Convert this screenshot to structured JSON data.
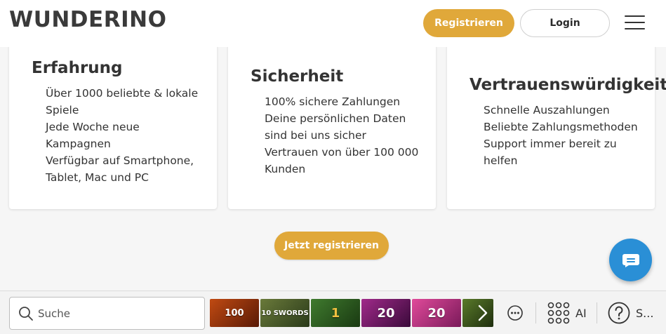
{
  "header": {
    "logo": "WUNDERINO",
    "register_label": "Registrieren",
    "login_label": "Login"
  },
  "cards": [
    {
      "title": "Erfahrung",
      "lines": [
        "Über 1000 beliebte & lokale",
        "Spiele",
        "Jede Woche neue",
        "Kampagnen",
        "Verfügbar auf Smartphone,",
        "Tablet, Mac und PC"
      ]
    },
    {
      "title": "Sicherheit",
      "lines": [
        "100% sichere Zahlungen",
        "Deine persönlichen Daten",
        "sind bei uns sicher",
        "Vertrauen von über 100 000",
        "Kunden"
      ]
    },
    {
      "title": "Vertrauenswürdigkeit",
      "lines": [
        "Schnelle Auszahlungen",
        "Beliebte Zahlungsmethoden",
        "Support immer bereit zu",
        "helfen"
      ]
    }
  ],
  "cta": {
    "label": "Jetzt registrieren"
  },
  "bottombar": {
    "search_placeholder": "Suche",
    "thumbnails": [
      {
        "text": "100",
        "bg": "#8a3a12"
      },
      {
        "text": "10 SWORDS",
        "bg": "#4a5a2a"
      },
      {
        "text": "1",
        "bg": "#2f5a24"
      },
      {
        "text": "20",
        "bg": "#7a1a6a"
      },
      {
        "text": "20",
        "bg": "#c02a7a"
      },
      {
        "text": "",
        "bg": "#3d5a1e"
      }
    ],
    "ai_label": "AI",
    "s_label": "S..."
  },
  "colors": {
    "accent": "#e0a83a",
    "chat": "#2a8fd6"
  }
}
